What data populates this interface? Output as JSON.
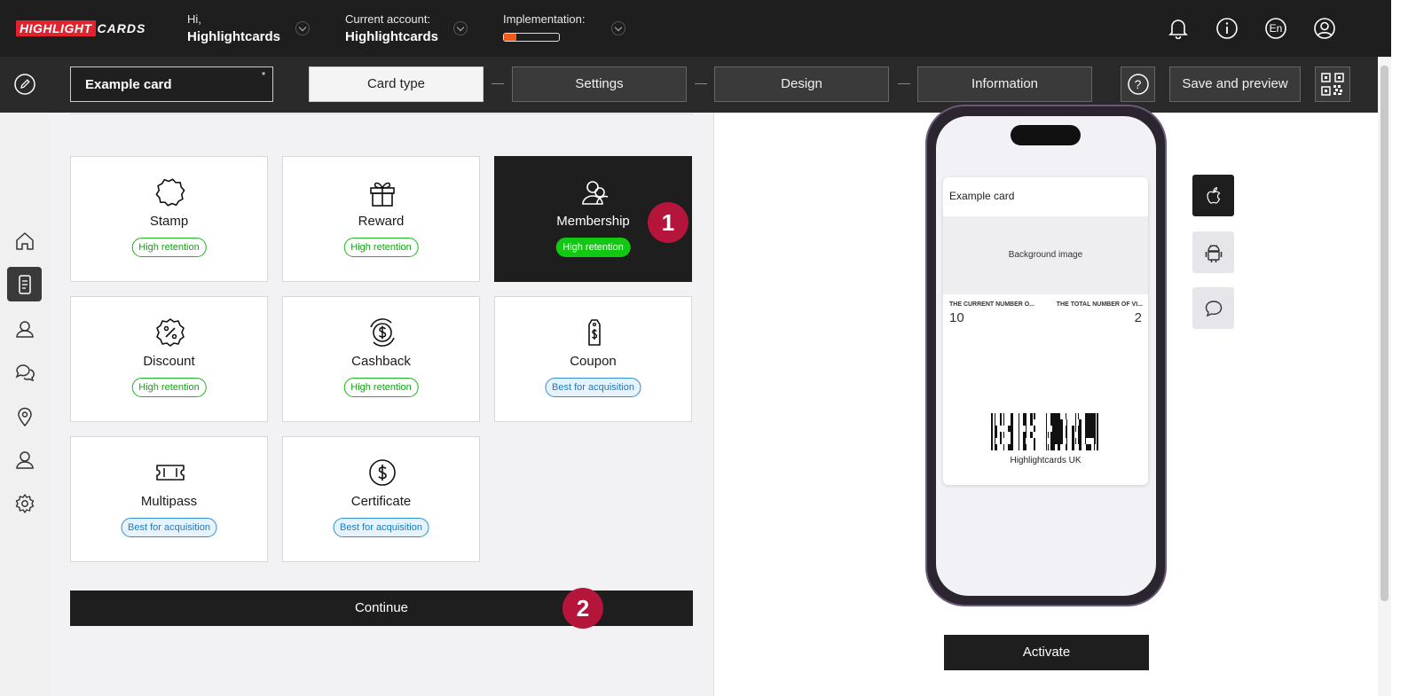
{
  "app": {
    "logo_part1": "HIGHLIGHT",
    "logo_part2": "CARDS"
  },
  "topbar": {
    "greeting": "Hi,",
    "user_name": "Highlightcards",
    "account_label": "Current account:",
    "account_name": "Highlightcards",
    "implementation_label": "Implementation:",
    "implementation_progress": 0.22,
    "language": "En"
  },
  "editor": {
    "card_name": "Example card",
    "card_name_marker": "*",
    "steps": [
      "Card type",
      "Settings",
      "Design",
      "Information"
    ],
    "active_step": "Card type",
    "help_label": "?",
    "save_label": "Save and preview"
  },
  "sidebar": {
    "items": [
      "home-icon",
      "card-icon",
      "users-icon",
      "chat-icon",
      "location-icon",
      "profile-icon",
      "settings-icon"
    ],
    "active": "card-icon"
  },
  "card_types": [
    {
      "name": "Stamp",
      "badge": "High retention",
      "badge_type": "green",
      "icon": "stamp-icon"
    },
    {
      "name": "Reward",
      "badge": "High retention",
      "badge_type": "green",
      "icon": "gift-icon"
    },
    {
      "name": "Membership",
      "badge": "High retention",
      "badge_type": "green",
      "icon": "membership-icon",
      "selected": true
    },
    {
      "name": "Discount",
      "badge": "High retention",
      "badge_type": "green",
      "icon": "discount-icon"
    },
    {
      "name": "Cashback",
      "badge": "High retention",
      "badge_type": "green",
      "icon": "cashback-icon"
    },
    {
      "name": "Coupon",
      "badge": "Best for acquisition",
      "badge_type": "blue",
      "icon": "coupon-icon"
    },
    {
      "name": "Multipass",
      "badge": "Best for acquisition",
      "badge_type": "blue",
      "icon": "ticket-icon"
    },
    {
      "name": "Certificate",
      "badge": "Best for acquisition",
      "badge_type": "blue",
      "icon": "certificate-icon"
    }
  ],
  "markers": [
    "1",
    "2"
  ],
  "continue_label": "Continue",
  "preview": {
    "pass_title": "Example card",
    "background_label": "Background image",
    "field1_label": "THE CURRENT NUMBER O...",
    "field1_value": "10",
    "field2_label": "THE TOTAL NUMBER OF VI...",
    "field2_value": "2",
    "barcode_caption": "Highlightcards UK",
    "platforms": [
      "apple-icon",
      "android-icon",
      "message-icon"
    ],
    "active_platform": "apple-icon",
    "activate_label": "Activate"
  },
  "colors": {
    "dark": "#1e1e1e",
    "brand_red": "#e1222f",
    "green": "#12c812",
    "blue": "#2a8fd6",
    "marker": "#b5153a",
    "progress": "#f05a1a"
  }
}
